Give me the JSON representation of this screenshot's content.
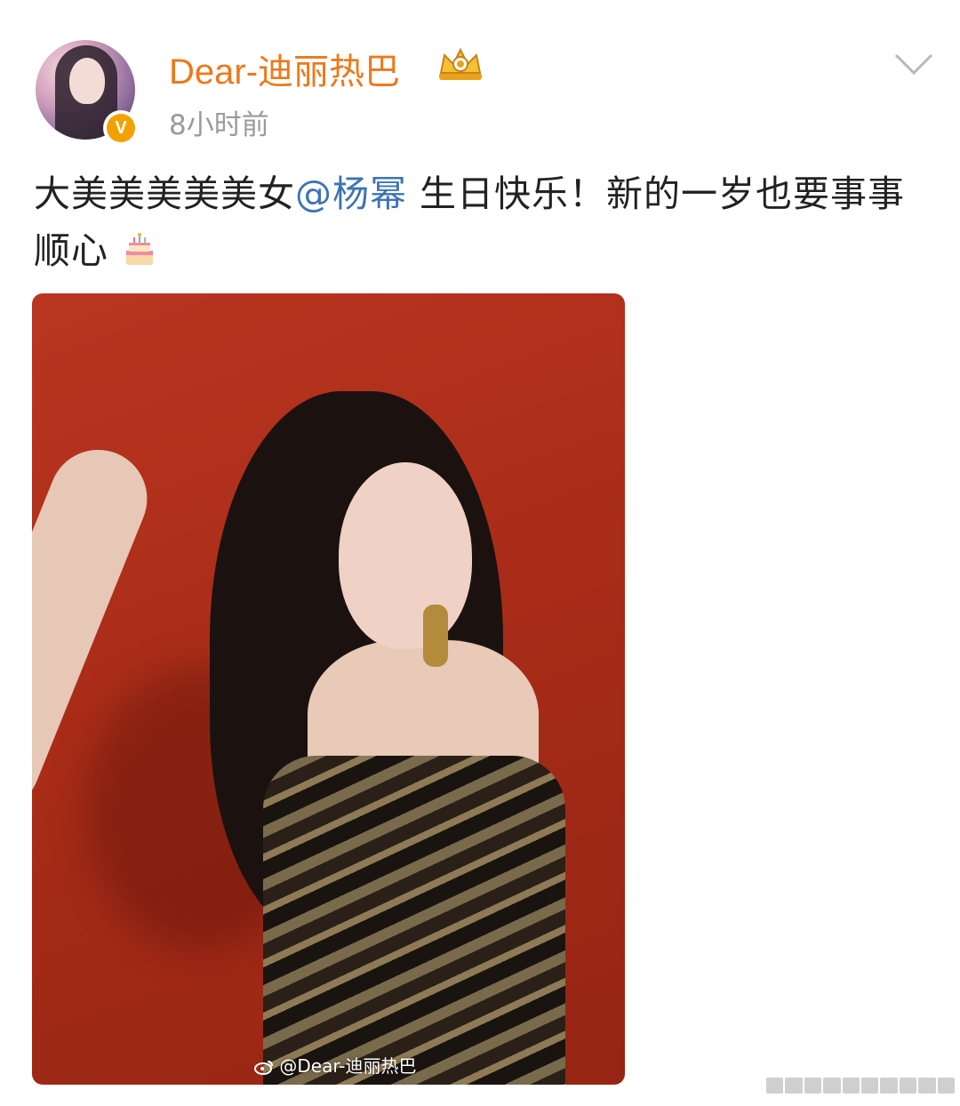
{
  "author": {
    "name": "Dear-迪丽热巴",
    "verified_badge": "V",
    "time": "8小时前"
  },
  "post": {
    "text_before": "大美美美美美女",
    "mention": "@杨幂",
    "text_after": " 生日快乐！新的一岁也要事事顺心",
    "emoji": "cake-emoji"
  },
  "image": {
    "watermark": "@Dear-迪丽热巴"
  },
  "colors": {
    "username": "#eb7a1b",
    "mention": "#3d73b5",
    "photo_background": "#a92c18",
    "badge": "#f2a100"
  },
  "icons": [
    "crown-icon",
    "chevron-down-icon",
    "weibo-icon",
    "cake-icon"
  ]
}
